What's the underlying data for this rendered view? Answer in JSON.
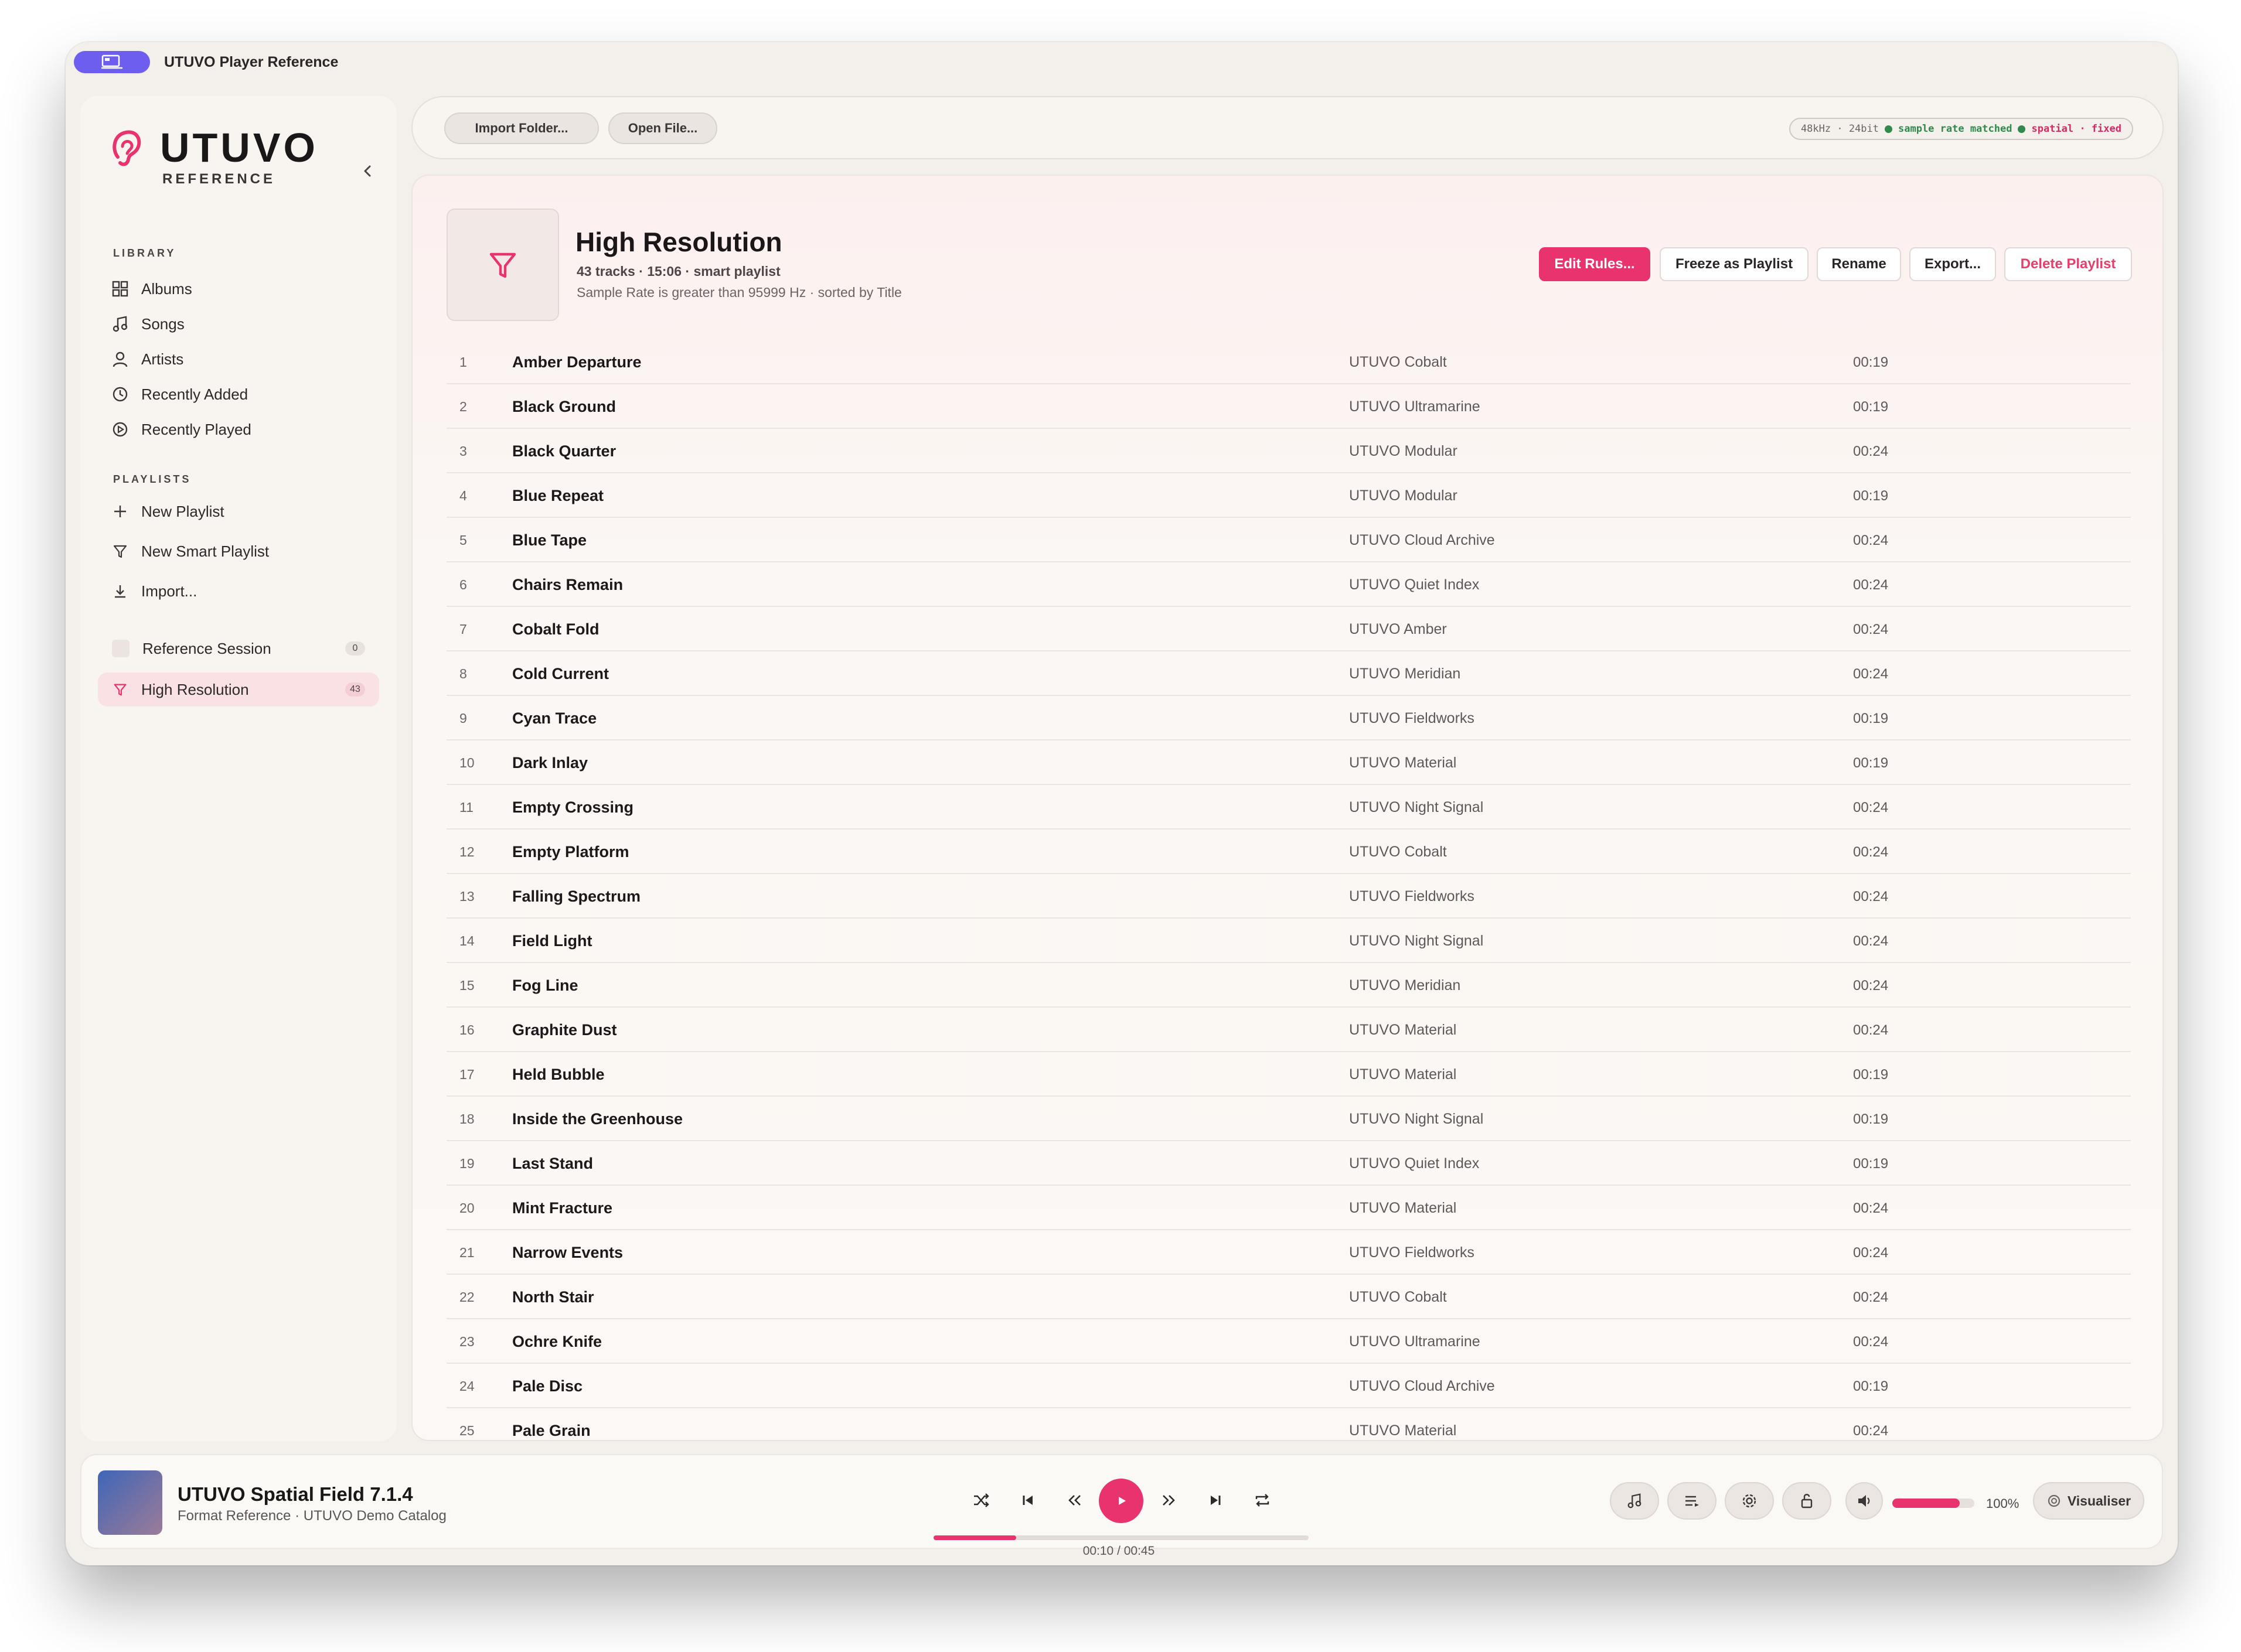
{
  "window": {
    "title": "UTUVO Player Reference"
  },
  "brand": {
    "name": "UTUVO",
    "subtitle": "REFERENCE"
  },
  "sidebar": {
    "library_label": "LIBRARY",
    "library": [
      {
        "label": "Albums",
        "icon": "grid-icon"
      },
      {
        "label": "Songs",
        "icon": "music-note-icon"
      },
      {
        "label": "Artists",
        "icon": "person-icon"
      },
      {
        "label": "Recently Added",
        "icon": "clock-icon"
      },
      {
        "label": "Recently Played",
        "icon": "play-circle-icon"
      }
    ],
    "playlists_label": "PLAYLISTS",
    "playlist_actions": [
      {
        "label": "New Playlist",
        "icon": "plus-icon"
      },
      {
        "label": "New Smart Playlist",
        "icon": "filter-icon"
      },
      {
        "label": "Import...",
        "icon": "download-icon"
      }
    ],
    "playlists": [
      {
        "label": "Reference Session",
        "count": "0"
      },
      {
        "label": "High Resolution",
        "count": "43"
      }
    ]
  },
  "toolbar": {
    "import_folder": "Import Folder...",
    "open_file": "Open File...",
    "status": {
      "format": "48kHz · 24bit",
      "matched": "sample rate matched",
      "spatial": "spatial · fixed"
    }
  },
  "playlist": {
    "title": "High Resolution",
    "meta": "43 tracks · 15:06 · smart playlist",
    "rule": "Sample Rate is greater than 95999 Hz · sorted by Title",
    "actions": {
      "edit": "Edit Rules...",
      "freeze": "Freeze as Playlist",
      "rename": "Rename",
      "export": "Export...",
      "delete": "Delete Playlist"
    }
  },
  "tracks": [
    {
      "n": "1",
      "title": "Amber Departure",
      "artist": "UTUVO Cobalt",
      "duration": "00:19"
    },
    {
      "n": "2",
      "title": "Black Ground",
      "artist": "UTUVO Ultramarine",
      "duration": "00:19"
    },
    {
      "n": "3",
      "title": "Black Quarter",
      "artist": "UTUVO Modular",
      "duration": "00:24"
    },
    {
      "n": "4",
      "title": "Blue Repeat",
      "artist": "UTUVO Modular",
      "duration": "00:19"
    },
    {
      "n": "5",
      "title": "Blue Tape",
      "artist": "UTUVO Cloud Archive",
      "duration": "00:24"
    },
    {
      "n": "6",
      "title": "Chairs Remain",
      "artist": "UTUVO Quiet Index",
      "duration": "00:24"
    },
    {
      "n": "7",
      "title": "Cobalt Fold",
      "artist": "UTUVO Amber",
      "duration": "00:24"
    },
    {
      "n": "8",
      "title": "Cold Current",
      "artist": "UTUVO Meridian",
      "duration": "00:24"
    },
    {
      "n": "9",
      "title": "Cyan Trace",
      "artist": "UTUVO Fieldworks",
      "duration": "00:19"
    },
    {
      "n": "10",
      "title": "Dark Inlay",
      "artist": "UTUVO Material",
      "duration": "00:19"
    },
    {
      "n": "11",
      "title": "Empty Crossing",
      "artist": "UTUVO Night Signal",
      "duration": "00:24"
    },
    {
      "n": "12",
      "title": "Empty Platform",
      "artist": "UTUVO Cobalt",
      "duration": "00:24"
    },
    {
      "n": "13",
      "title": "Falling Spectrum",
      "artist": "UTUVO Fieldworks",
      "duration": "00:24"
    },
    {
      "n": "14",
      "title": "Field Light",
      "artist": "UTUVO Night Signal",
      "duration": "00:24"
    },
    {
      "n": "15",
      "title": "Fog Line",
      "artist": "UTUVO Meridian",
      "duration": "00:24"
    },
    {
      "n": "16",
      "title": "Graphite Dust",
      "artist": "UTUVO Material",
      "duration": "00:24"
    },
    {
      "n": "17",
      "title": "Held Bubble",
      "artist": "UTUVO Material",
      "duration": "00:19"
    },
    {
      "n": "18",
      "title": "Inside the Greenhouse",
      "artist": "UTUVO Night Signal",
      "duration": "00:19"
    },
    {
      "n": "19",
      "title": "Last Stand",
      "artist": "UTUVO Quiet Index",
      "duration": "00:19"
    },
    {
      "n": "20",
      "title": "Mint Fracture",
      "artist": "UTUVO Material",
      "duration": "00:24"
    },
    {
      "n": "21",
      "title": "Narrow Events",
      "artist": "UTUVO Fieldworks",
      "duration": "00:24"
    },
    {
      "n": "22",
      "title": "North Stair",
      "artist": "UTUVO Cobalt",
      "duration": "00:24"
    },
    {
      "n": "23",
      "title": "Ochre Knife",
      "artist": "UTUVO Ultramarine",
      "duration": "00:24"
    },
    {
      "n": "24",
      "title": "Pale Disc",
      "artist": "UTUVO Cloud Archive",
      "duration": "00:19"
    },
    {
      "n": "25",
      "title": "Pale Grain",
      "artist": "UTUVO Material",
      "duration": "00:24"
    }
  ],
  "player": {
    "title": "UTUVO Spatial Field 7.1.4",
    "subtitle": "Format Reference · UTUVO Demo Catalog",
    "time": "00:10 / 00:45",
    "progress": 0.22,
    "volume_label": "100%",
    "volume": 0.82,
    "visualiser": "Visualiser"
  },
  "colors": {
    "accent": "#e8336f",
    "app_pill": "#6d5ef0",
    "status_green": "#2f8a4c"
  }
}
